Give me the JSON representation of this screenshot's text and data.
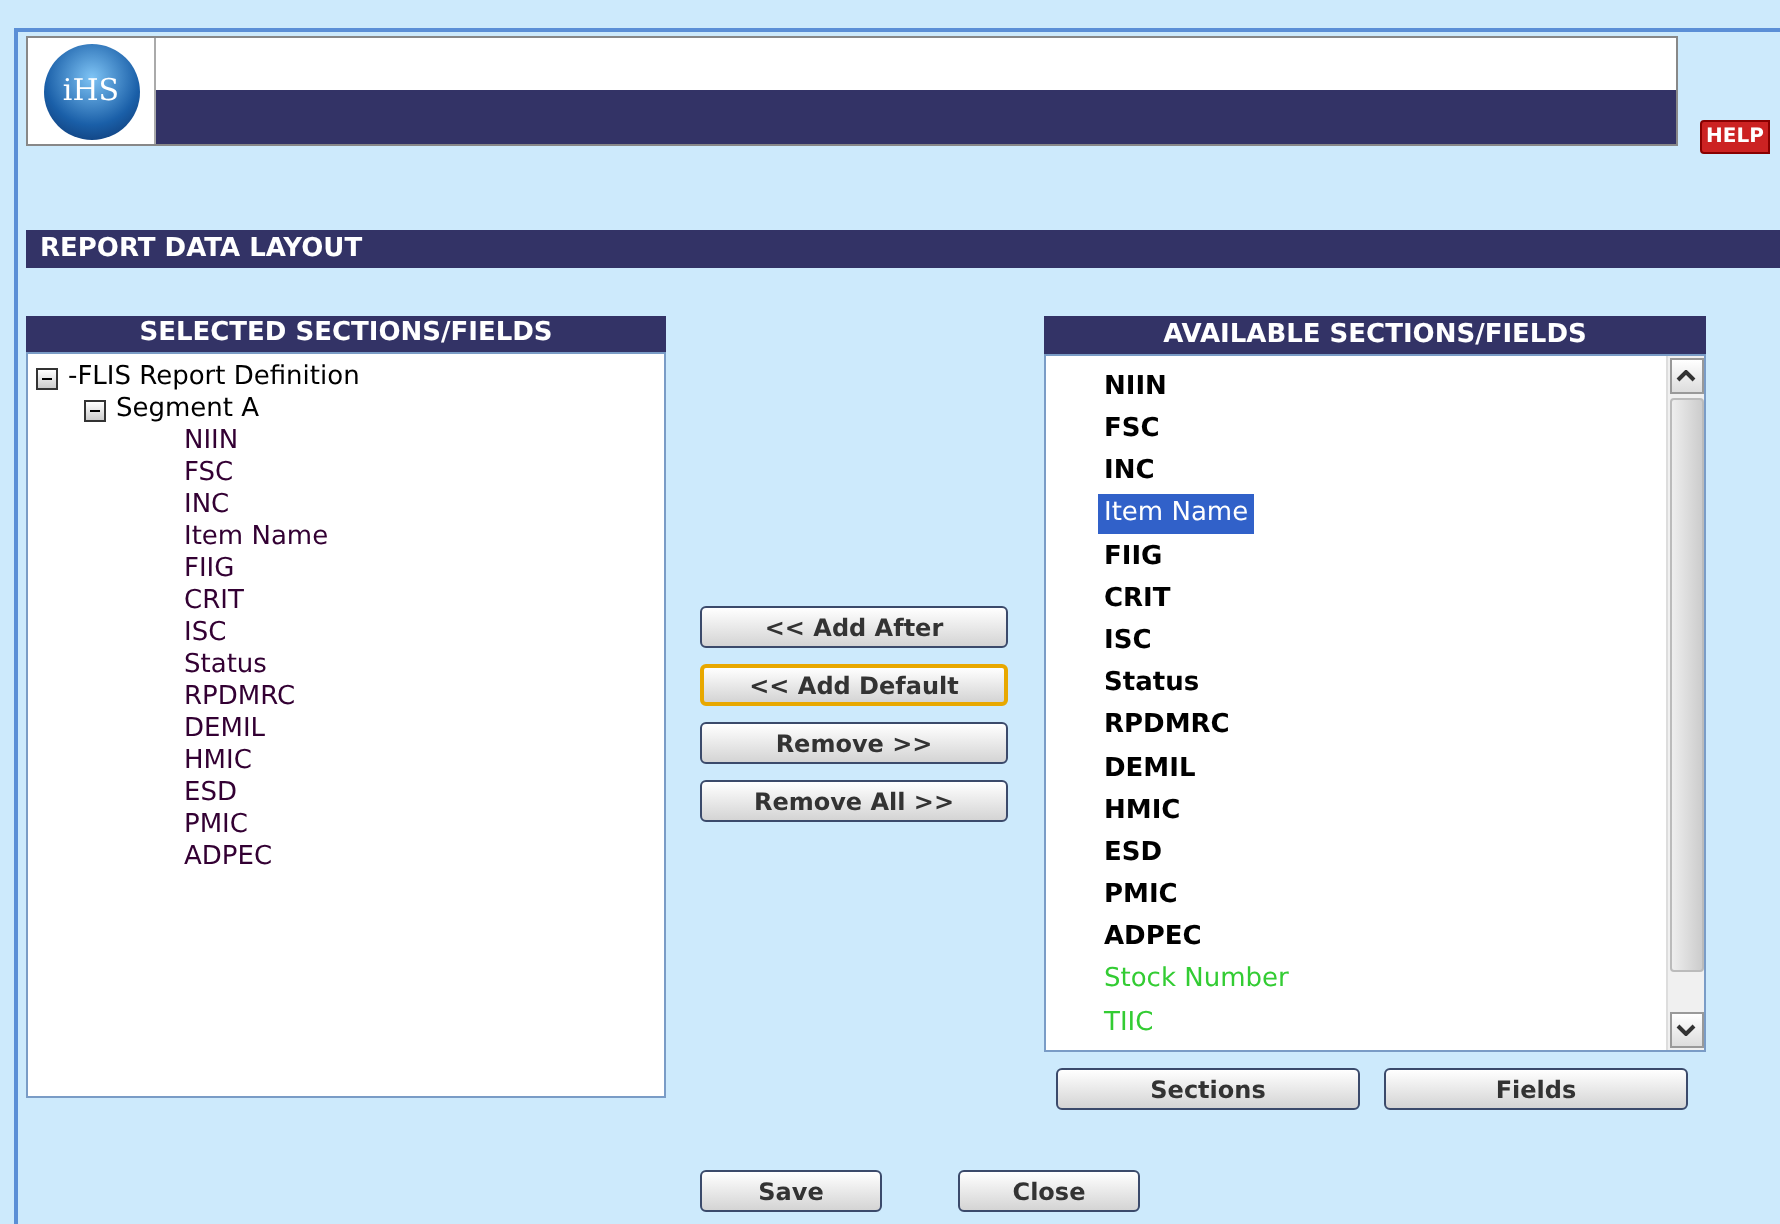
{
  "header": {
    "logo_text": "iHS",
    "help": "HELP"
  },
  "section_title": "REPORT DATA LAYOUT",
  "selected_panel": {
    "title": "SELECTED SECTIONS/FIELDS",
    "tree": [
      {
        "label": "-FLIS Report Definition",
        "expanded": true,
        "children": [
          {
            "label": "Segment A",
            "expanded": true,
            "children": [
              {
                "label": "NIIN"
              },
              {
                "label": "FSC"
              },
              {
                "label": "INC"
              },
              {
                "label": "Item Name"
              },
              {
                "label": "FIIG"
              },
              {
                "label": "CRIT"
              },
              {
                "label": "ISC"
              },
              {
                "label": "Status"
              },
              {
                "label": "RPDMRC"
              },
              {
                "label": "DEMIL"
              },
              {
                "label": "HMIC"
              },
              {
                "label": "ESD"
              },
              {
                "label": "PMIC"
              },
              {
                "label": "ADPEC"
              }
            ]
          }
        ]
      }
    ]
  },
  "move_buttons": [
    {
      "label": "<< Add After",
      "focused": false
    },
    {
      "label": "<< Add Default",
      "focused": true
    },
    {
      "label": "Remove >>",
      "focused": false
    },
    {
      "label": "Remove All >>",
      "focused": false
    }
  ],
  "available_panel": {
    "title": "AVAILABLE SECTIONS/FIELDS",
    "items": [
      {
        "label": "NIIN",
        "kind": "bold",
        "selected": false
      },
      {
        "label": "FSC",
        "kind": "bold",
        "selected": false
      },
      {
        "label": "INC",
        "kind": "bold",
        "selected": false
      },
      {
        "label": "Item Name",
        "kind": "plain",
        "selected": true
      },
      {
        "label": "FIIG",
        "kind": "bold",
        "selected": false
      },
      {
        "label": "CRIT",
        "kind": "bold",
        "selected": false
      },
      {
        "label": "ISC",
        "kind": "bold",
        "selected": false
      },
      {
        "label": "Status",
        "kind": "bold",
        "selected": false
      },
      {
        "label": "RPDMRC",
        "kind": "bold",
        "selected": false
      },
      {
        "label": "DEMIL",
        "kind": "bold",
        "selected": false
      },
      {
        "label": "HMIC",
        "kind": "bold",
        "selected": false
      },
      {
        "label": "ESD",
        "kind": "bold",
        "selected": false
      },
      {
        "label": "PMIC",
        "kind": "bold",
        "selected": false
      },
      {
        "label": "ADPEC",
        "kind": "bold",
        "selected": false
      },
      {
        "label": "Stock Number",
        "kind": "green",
        "selected": false
      },
      {
        "label": "TIIC",
        "kind": "green",
        "selected": false
      }
    ],
    "buttons": [
      "Sections",
      "Fields"
    ]
  },
  "footer_buttons": [
    "Save",
    "Close"
  ]
}
